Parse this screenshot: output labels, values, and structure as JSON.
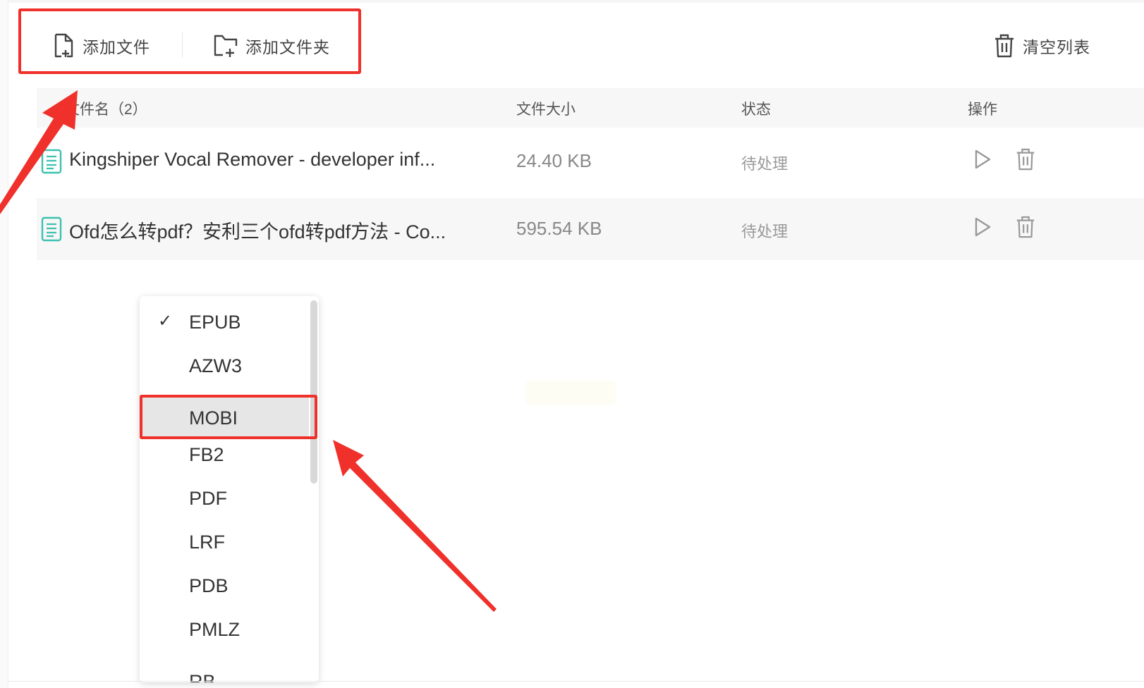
{
  "toolbar": {
    "add_file_label": "添加文件",
    "add_folder_label": "添加文件夹",
    "clear_list_label": "清空列表"
  },
  "table": {
    "headers": {
      "name": "文件名（2）",
      "size": "文件大小",
      "status": "状态",
      "ops": "操作"
    },
    "rows": [
      {
        "name": "Kingshiper Vocal Remover - developer inf...",
        "size": "24.40 KB",
        "status": "待处理"
      },
      {
        "name": "Ofd怎么转pdf？安利三个ofd转pdf方法 - Co...",
        "size": "595.54 KB",
        "status": "待处理"
      }
    ]
  },
  "format_dropdown": {
    "selected": "EPUB",
    "highlighted": "MOBI",
    "check_mark": "✓",
    "options": [
      "EPUB",
      "AZW3",
      "MOBI",
      "FB2",
      "PDF",
      "LRF",
      "PDB",
      "PMLZ",
      "RB"
    ]
  },
  "colors": {
    "annotation_red": "#f0302a",
    "file_icon_teal": "#3cc1b0",
    "header_bg": "#f7f7f7"
  },
  "icons": {
    "add_file": "file-plus-icon",
    "add_folder": "folder-plus-icon",
    "clear": "trash-icon",
    "file": "document-icon",
    "play": "play-icon",
    "delete": "trash-icon"
  }
}
